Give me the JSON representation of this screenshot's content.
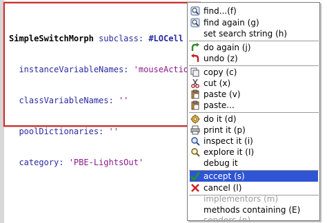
{
  "editor": {
    "lines": [
      {
        "a": "SimpleSwitchMorph",
        "b": " subclass: ",
        "c": "#LOCell"
      },
      {
        "a": "  instanceVariableNames: ",
        "b": "'mouseAction'"
      },
      {
        "a": "  classVariableNames: ",
        "b": "''"
      },
      {
        "a": "  poolDictionaries: ",
        "b": "''"
      },
      {
        "a": "  category: ",
        "b": "'PBE-LightsOut'"
      }
    ]
  },
  "menu": {
    "items": [
      {
        "label": "find...(f)",
        "icon": "find-icon"
      },
      {
        "label": "find again (g)",
        "icon": "find-again-icon"
      },
      {
        "label": "set search string (h)",
        "icon": ""
      },
      {
        "label": "do again (j)",
        "icon": "redo-icon"
      },
      {
        "label": "undo (z)",
        "icon": "undo-icon"
      },
      {
        "label": "copy (c)",
        "icon": "copy-icon"
      },
      {
        "label": "cut (x)",
        "icon": "cut-icon"
      },
      {
        "label": "paste (v)",
        "icon": "paste-icon"
      },
      {
        "label": "paste...",
        "icon": "paste-special-icon"
      },
      {
        "label": "do it (d)",
        "icon": "do-it-icon"
      },
      {
        "label": "print it (p)",
        "icon": "print-it-icon"
      },
      {
        "label": "inspect it (i)",
        "icon": "inspect-icon"
      },
      {
        "label": "explore it (I)",
        "icon": "explore-icon"
      },
      {
        "label": "debug it",
        "icon": ""
      },
      {
        "label": "accept (s)",
        "icon": "accept-icon"
      },
      {
        "label": "cancel (l)",
        "icon": "cancel-icon"
      },
      {
        "label": "implementors (m)",
        "icon": ""
      },
      {
        "label": "methods containing (E)",
        "icon": ""
      },
      {
        "label": "senders (n)",
        "icon": ""
      }
    ],
    "selected_label": "accept (s)"
  },
  "colors": {
    "selection": "#2f55d4",
    "editor_border": "#c8312f"
  }
}
